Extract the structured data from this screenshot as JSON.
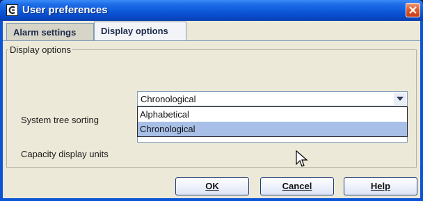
{
  "window": {
    "title": "User preferences",
    "icons": {
      "app": "app-icon",
      "close": "close-icon"
    }
  },
  "tabs": [
    {
      "label": "Alarm settings",
      "active": false
    },
    {
      "label": "Display options",
      "active": true
    }
  ],
  "group": {
    "legend": "Display options",
    "rows": [
      {
        "label": "System tree sorting",
        "value": "Chronological"
      },
      {
        "label": "Capacity display units",
        "value": ""
      }
    ]
  },
  "dropdown": {
    "options": [
      "Alphabetical",
      "Chronological"
    ],
    "selected": "Chronological"
  },
  "buttons": {
    "ok": "OK",
    "cancel": "Cancel",
    "help": "Help"
  },
  "colors": {
    "title_bar": "#0a54d6",
    "close_button": "#d9582c",
    "selected_option": "#a8c0e8"
  }
}
